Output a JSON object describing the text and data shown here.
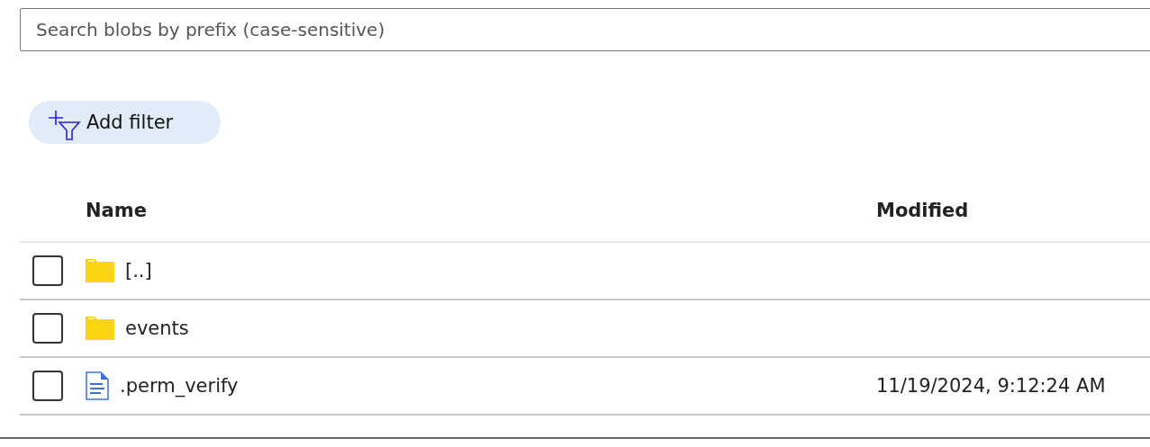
{
  "search": {
    "placeholder": "Search blobs by prefix (case-sensitive)"
  },
  "add_filter": {
    "label": "Add filter"
  },
  "table": {
    "columns": [
      "Name",
      "Modified"
    ],
    "rows": [
      {
        "kind": "folder",
        "name": "[..]",
        "modified": "",
        "checked": false
      },
      {
        "kind": "folder",
        "name": "events",
        "modified": "",
        "checked": false
      },
      {
        "kind": "file",
        "name": ".perm_verify",
        "modified": "11/19/2024, 9:12:24 AM",
        "checked": false
      }
    ]
  }
}
